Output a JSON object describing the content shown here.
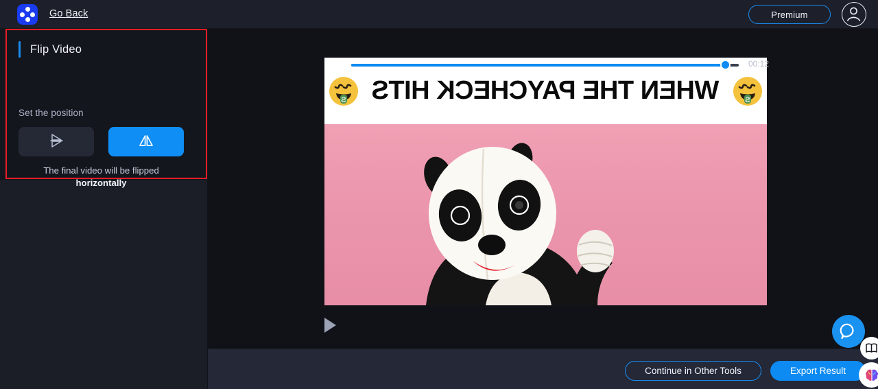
{
  "header": {
    "logo_name": "dot-grid-logo",
    "go_back_label": "Go Back",
    "premium_label": "Premium",
    "avatar_name": "user-avatar-icon"
  },
  "sidebar": {
    "panel": {
      "title": "Flip Video",
      "section_label": "Set the position",
      "buttons": [
        {
          "name": "flip-vertical-button",
          "icon": "flip-vertical-icon",
          "active": false
        },
        {
          "name": "flip-horizontal-button",
          "icon": "flip-horizontal-icon",
          "active": true
        }
      ],
      "hint_text": "The final video will be flipped",
      "hint_emphasis": "horizontally"
    }
  },
  "video": {
    "banner_text": "WHEN THE PAYCHECK HITS",
    "emoji_name": "money-mouth-face-emoji",
    "subject": "panda-mascot",
    "flipped": "horizontal"
  },
  "player": {
    "play_icon": "play-icon",
    "progress_percent": 97,
    "timestamp": "00:12"
  },
  "footer": {
    "continue_label": "Continue in Other Tools",
    "export_label": "Export Result"
  },
  "widgets": {
    "chat_icon": "chat-bubble-icon",
    "book_icon": "book-icon",
    "brain_icon": "brain-icon"
  },
  "colors": {
    "accent_blue": "#0d8bf2",
    "annotation_red": "#ec1c24",
    "panel_bg": "#14161d",
    "sidebar_bg": "#1b1e27",
    "footer_bg": "#242837"
  }
}
